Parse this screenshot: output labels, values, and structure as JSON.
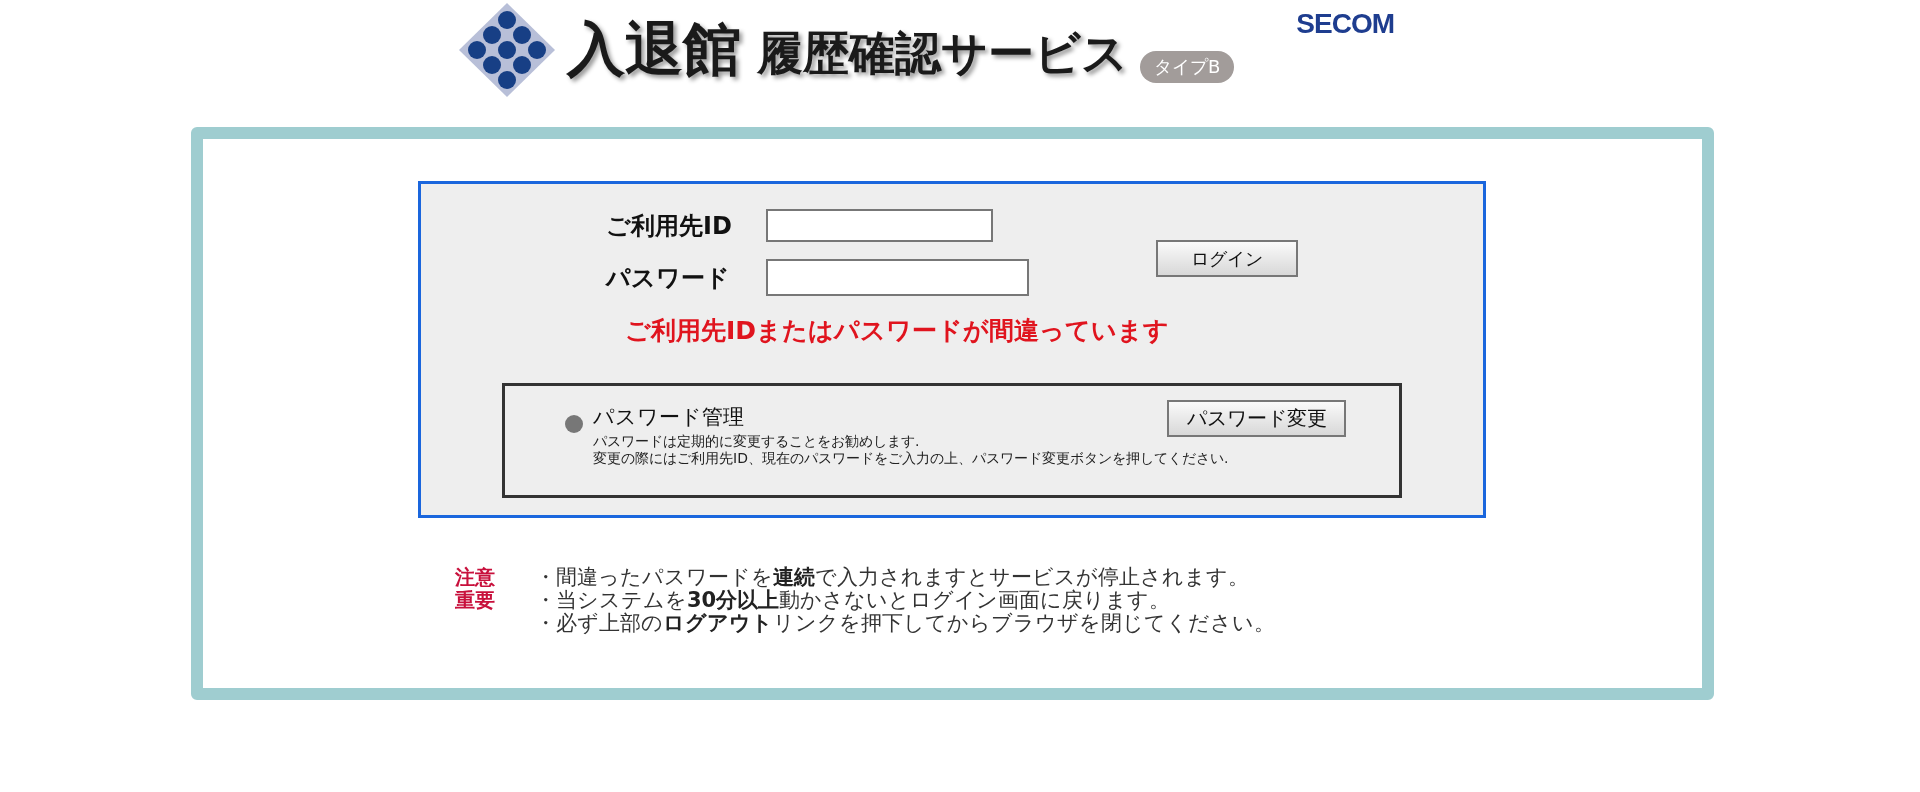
{
  "header": {
    "title_main": "入退館",
    "title_sub": "履歴確認サービス",
    "type_badge": "タイプB",
    "brand": "SECOM"
  },
  "login": {
    "fields": [
      {
        "label": "ご利用先ID",
        "kind": "text"
      },
      {
        "label": "パスワード",
        "kind": "password"
      }
    ],
    "login_button": "ログイン",
    "error": "ご利用先IDまたはパスワードが間違っています"
  },
  "password_management": {
    "title": "パスワード管理",
    "button": "パスワード変更",
    "lines": [
      "パスワードは定期的に変更することをお勧めします.",
      "変更の際にはご利用先ID、現在のパスワードをご入力の上、パスワード変更ボタンを押してください."
    ]
  },
  "notice": {
    "labels": [
      "注意",
      "重要"
    ],
    "items": [
      "・間違ったパスワードを**連続**で入力されますとサービスが停止されます。",
      "・当システムを**30分以上**動かさないとログイン画面に戻ります。",
      "・必ず上部の**ログアウト**リンクを押下してからブラウザを閉じてください。"
    ]
  }
}
